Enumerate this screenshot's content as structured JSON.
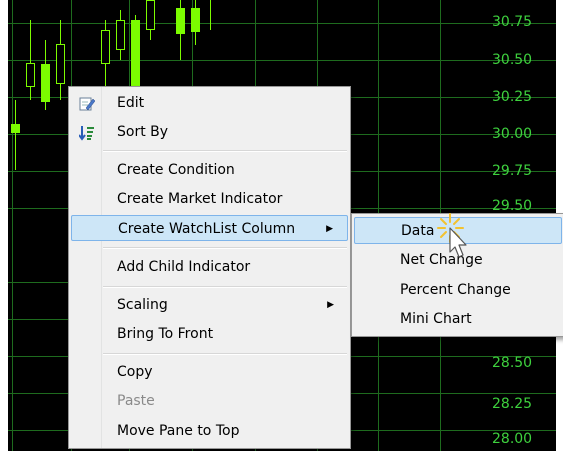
{
  "price_axis": {
    "labels": [
      "30.75",
      "30.50",
      "30.25",
      "30.00",
      "29.75",
      "29.50",
      "28.50",
      "28.25",
      "28.00"
    ]
  },
  "context_menu": {
    "items": [
      {
        "label": "Edit",
        "icon": "edit-icon",
        "enabled": true
      },
      {
        "label": "Sort By",
        "icon": "sort-icon",
        "enabled": true
      },
      {
        "label": "Create Condition",
        "enabled": true
      },
      {
        "label": "Create Market Indicator",
        "enabled": true
      },
      {
        "label": "Create WatchList Column",
        "enabled": true,
        "submenu": true,
        "highlighted": true
      },
      {
        "label": "Add Child Indicator",
        "enabled": true
      },
      {
        "label": "Scaling",
        "enabled": true,
        "submenu": true
      },
      {
        "label": "Bring To Front",
        "enabled": true
      },
      {
        "label": "Copy",
        "enabled": true
      },
      {
        "label": "Paste",
        "enabled": false
      },
      {
        "label": "Move Pane to Top",
        "enabled": true
      }
    ]
  },
  "submenu": {
    "items": [
      {
        "label": "Data",
        "highlighted": true
      },
      {
        "label": "Net Change"
      },
      {
        "label": "Percent Change"
      },
      {
        "label": "Mini Chart"
      }
    ]
  },
  "colors": {
    "chart_background": "#000000",
    "price_text": "#3ed13e",
    "candle": "#7cfc00",
    "grid": "#1e6b1e",
    "menu_background": "#f0f0f0",
    "menu_highlight": "#cde6f7"
  }
}
